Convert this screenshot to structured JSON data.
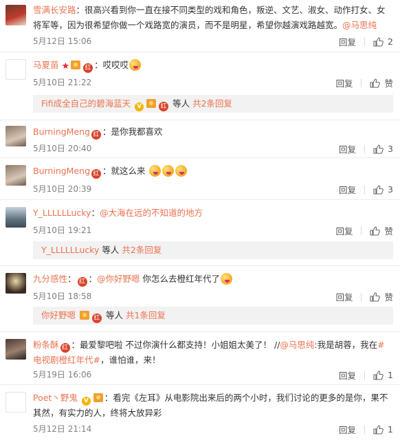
{
  "reply_label": "回复",
  "like_label": "赞",
  "comments": [
    {
      "user": "雪满长安路",
      "text": "很高兴看到你一直在接不同类型的戏和角色，叛逆、文艺、淑女、动作打女、女将军等，因为很希望你做一个戏路宽的演员，而不是明星，希望你越演戏路越宽。",
      "mention": "@马思纯",
      "time": "5月12日 15:06",
      "likes": "2"
    },
    {
      "user": "马夏苗",
      "text": "哎哎哎",
      "time": "5月10日 21:22",
      "sub_user": "Fifi成全自己的碧海蓝天",
      "sub_mid": "等人",
      "sub_total": "共2条回复"
    },
    {
      "user": "BurningMeng",
      "text": "是你我都喜欢",
      "time": "5月10日 20:40",
      "likes": "3"
    },
    {
      "user": "BurningMeng",
      "text": "就这么来",
      "time": "5月10日 20:39",
      "likes": "3"
    },
    {
      "user": "Y_LLLLLLucky",
      "mention": "@大海在远的不知道的地方",
      "time": "5月10日 19:21",
      "sub_user": "Y_LLLLLLucky",
      "sub_mid": "等人",
      "sub_total": "共2条回复"
    },
    {
      "user": "九分感性",
      "mention": "@你好野嗯",
      "text": "你怎么去橙红年代了",
      "time": "5月10日 18:58",
      "sub_user": "你好野嗯",
      "sub_mid": "等人",
      "sub_total": "共1条回复"
    },
    {
      "user": "粉条酥",
      "text_a": "最爱黎吧啦 不过你演什么都支持！小姐姐太美了！ //",
      "mention": "@马思纯",
      "text_b": ":我是胡蓉，我在",
      "topic": "#电视剧橙红年代#",
      "text_c": "，谁怕谁，来！",
      "time": "5月19日 16:06",
      "likes": "1"
    },
    {
      "user": "Poet丶野鬼",
      "text": "看完《左耳》从电影院出来后的两个小时，我们讨论的更多的是你，果不其然，有实力的人，终将大放异彩",
      "time": "5月12日 21:14",
      "likes": "1"
    }
  ],
  "colors": {
    "accent": "#eb7350",
    "time": "#808080",
    "subbox": "#f2f2f2",
    "divider": "#ececec"
  },
  "icons": [
    "like-icon",
    "vip-badge-icon",
    "red-badge-icon",
    "medal-icon",
    "emoji-icon"
  ]
}
